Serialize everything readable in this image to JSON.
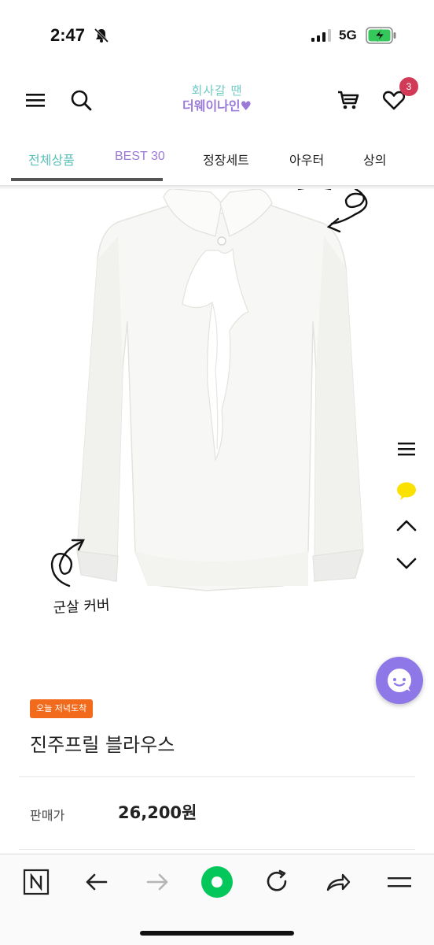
{
  "status": {
    "time": "2:47",
    "network": "5G"
  },
  "header": {
    "logo_line1": "회사갈 땐",
    "logo_line2": "더웨이나인♥",
    "cart_count": "3"
  },
  "tabs": [
    {
      "label": "전체상품",
      "color": "#5bbfb7"
    },
    {
      "label": "BEST 30",
      "color": "#9a7ad6"
    },
    {
      "label": "정장세트",
      "color": "#222222"
    },
    {
      "label": "아우터",
      "color": "#222222"
    },
    {
      "label": "상의",
      "color": "#222222"
    }
  ],
  "image": {
    "annotation": "군살 커버"
  },
  "product": {
    "badge": "오늘 저녁도착",
    "name": "진주프릴 블라우스",
    "price_label": "판매가",
    "price": "26,200원"
  },
  "icons": {
    "header": [
      "menu-icon",
      "search-icon",
      "cart-icon",
      "heart-icon"
    ],
    "side": [
      "list-icon",
      "kakao-talk-icon",
      "chevron-up-icon",
      "chevron-down-icon"
    ],
    "toolbar": [
      "naver-n-icon",
      "back-arrow-icon",
      "forward-arrow-icon",
      "naver-green-dot-icon",
      "reload-icon",
      "share-icon",
      "hamburger-icon"
    ]
  },
  "colors": {
    "accent_mint": "#5bbfb7",
    "accent_purple": "#9a7ad6",
    "badge_orange": "#f26b1d",
    "cart_badge": "#d23b57",
    "chat_fab": "#8e78e8",
    "naver_green": "#03c75a"
  }
}
